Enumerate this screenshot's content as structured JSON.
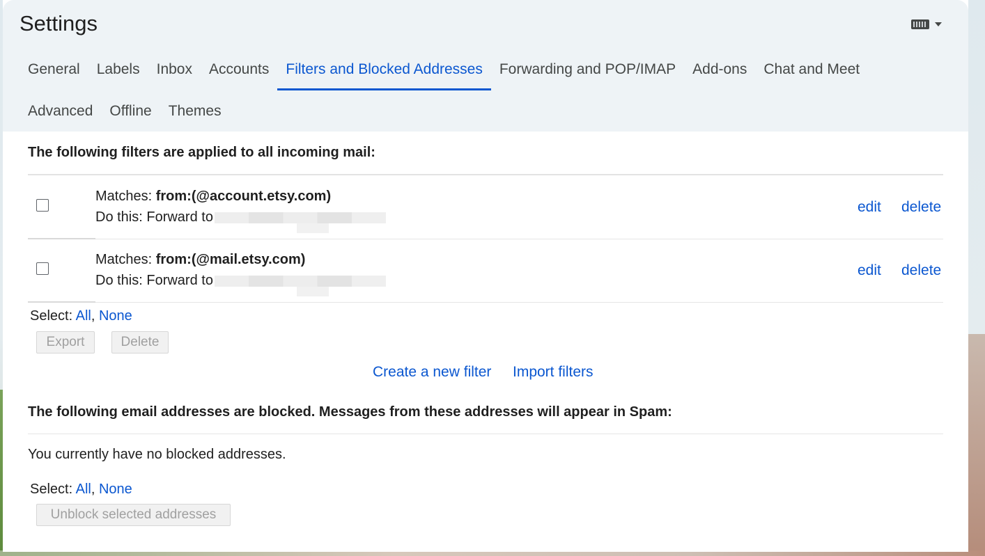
{
  "window": {
    "title": "Settings"
  },
  "tabs_row1": [
    {
      "label": "General"
    },
    {
      "label": "Labels"
    },
    {
      "label": "Inbox"
    },
    {
      "label": "Accounts"
    },
    {
      "label": "Filters and Blocked Addresses",
      "active": true
    },
    {
      "label": "Forwarding and POP/IMAP"
    },
    {
      "label": "Add-ons"
    },
    {
      "label": "Chat and Meet"
    }
  ],
  "tabs_row2": [
    {
      "label": "Advanced"
    },
    {
      "label": "Offline"
    },
    {
      "label": "Themes"
    }
  ],
  "filters": {
    "heading": "The following filters are applied to all incoming mail:",
    "rows": [
      {
        "matches_prefix": "Matches:",
        "matches_value": "from:(@account.etsy.com)",
        "action_prefix": "Do this: Forward to",
        "edit": "edit",
        "delete": "delete"
      },
      {
        "matches_prefix": "Matches:",
        "matches_value": "from:(@mail.etsy.com)",
        "action_prefix": "Do this: Forward to",
        "edit": "edit",
        "delete": "delete"
      }
    ],
    "select_label": "Select:",
    "select_all": "All",
    "select_none": "None",
    "export_btn": "Export",
    "delete_btn": "Delete",
    "create_link": "Create a new filter",
    "import_link": "Import filters"
  },
  "blocked": {
    "heading": "The following email addresses are blocked. Messages from these addresses will appear in Spam:",
    "empty_text": "You currently have no blocked addresses.",
    "select_label": "Select:",
    "select_all": "All",
    "select_none": "None",
    "unblock_btn": "Unblock selected addresses"
  },
  "colors": {
    "accent": "#0b57d0",
    "header_bg": "#eef3f6",
    "text": "#1f1f1f"
  },
  "icons": {
    "keyboard": "keyboard-icon",
    "dropdown": "chevron-down-icon"
  }
}
